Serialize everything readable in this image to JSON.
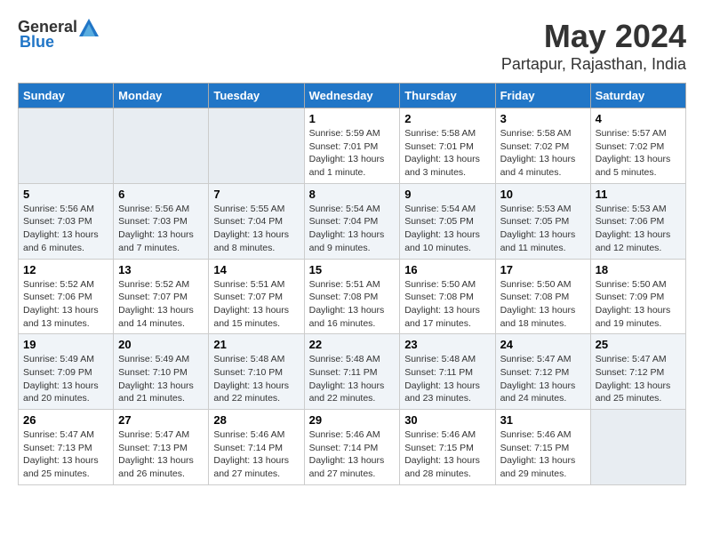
{
  "header": {
    "logo_general": "General",
    "logo_blue": "Blue",
    "title": "May 2024",
    "subtitle": "Partapur, Rajasthan, India"
  },
  "days_of_week": [
    "Sunday",
    "Monday",
    "Tuesday",
    "Wednesday",
    "Thursday",
    "Friday",
    "Saturday"
  ],
  "weeks": [
    [
      {
        "day": "",
        "info": ""
      },
      {
        "day": "",
        "info": ""
      },
      {
        "day": "",
        "info": ""
      },
      {
        "day": "1",
        "info": "Sunrise: 5:59 AM\nSunset: 7:01 PM\nDaylight: 13 hours and 1 minute."
      },
      {
        "day": "2",
        "info": "Sunrise: 5:58 AM\nSunset: 7:01 PM\nDaylight: 13 hours and 3 minutes."
      },
      {
        "day": "3",
        "info": "Sunrise: 5:58 AM\nSunset: 7:02 PM\nDaylight: 13 hours and 4 minutes."
      },
      {
        "day": "4",
        "info": "Sunrise: 5:57 AM\nSunset: 7:02 PM\nDaylight: 13 hours and 5 minutes."
      }
    ],
    [
      {
        "day": "5",
        "info": "Sunrise: 5:56 AM\nSunset: 7:03 PM\nDaylight: 13 hours and 6 minutes."
      },
      {
        "day": "6",
        "info": "Sunrise: 5:56 AM\nSunset: 7:03 PM\nDaylight: 13 hours and 7 minutes."
      },
      {
        "day": "7",
        "info": "Sunrise: 5:55 AM\nSunset: 7:04 PM\nDaylight: 13 hours and 8 minutes."
      },
      {
        "day": "8",
        "info": "Sunrise: 5:54 AM\nSunset: 7:04 PM\nDaylight: 13 hours and 9 minutes."
      },
      {
        "day": "9",
        "info": "Sunrise: 5:54 AM\nSunset: 7:05 PM\nDaylight: 13 hours and 10 minutes."
      },
      {
        "day": "10",
        "info": "Sunrise: 5:53 AM\nSunset: 7:05 PM\nDaylight: 13 hours and 11 minutes."
      },
      {
        "day": "11",
        "info": "Sunrise: 5:53 AM\nSunset: 7:06 PM\nDaylight: 13 hours and 12 minutes."
      }
    ],
    [
      {
        "day": "12",
        "info": "Sunrise: 5:52 AM\nSunset: 7:06 PM\nDaylight: 13 hours and 13 minutes."
      },
      {
        "day": "13",
        "info": "Sunrise: 5:52 AM\nSunset: 7:07 PM\nDaylight: 13 hours and 14 minutes."
      },
      {
        "day": "14",
        "info": "Sunrise: 5:51 AM\nSunset: 7:07 PM\nDaylight: 13 hours and 15 minutes."
      },
      {
        "day": "15",
        "info": "Sunrise: 5:51 AM\nSunset: 7:08 PM\nDaylight: 13 hours and 16 minutes."
      },
      {
        "day": "16",
        "info": "Sunrise: 5:50 AM\nSunset: 7:08 PM\nDaylight: 13 hours and 17 minutes."
      },
      {
        "day": "17",
        "info": "Sunrise: 5:50 AM\nSunset: 7:08 PM\nDaylight: 13 hours and 18 minutes."
      },
      {
        "day": "18",
        "info": "Sunrise: 5:50 AM\nSunset: 7:09 PM\nDaylight: 13 hours and 19 minutes."
      }
    ],
    [
      {
        "day": "19",
        "info": "Sunrise: 5:49 AM\nSunset: 7:09 PM\nDaylight: 13 hours and 20 minutes."
      },
      {
        "day": "20",
        "info": "Sunrise: 5:49 AM\nSunset: 7:10 PM\nDaylight: 13 hours and 21 minutes."
      },
      {
        "day": "21",
        "info": "Sunrise: 5:48 AM\nSunset: 7:10 PM\nDaylight: 13 hours and 22 minutes."
      },
      {
        "day": "22",
        "info": "Sunrise: 5:48 AM\nSunset: 7:11 PM\nDaylight: 13 hours and 22 minutes."
      },
      {
        "day": "23",
        "info": "Sunrise: 5:48 AM\nSunset: 7:11 PM\nDaylight: 13 hours and 23 minutes."
      },
      {
        "day": "24",
        "info": "Sunrise: 5:47 AM\nSunset: 7:12 PM\nDaylight: 13 hours and 24 minutes."
      },
      {
        "day": "25",
        "info": "Sunrise: 5:47 AM\nSunset: 7:12 PM\nDaylight: 13 hours and 25 minutes."
      }
    ],
    [
      {
        "day": "26",
        "info": "Sunrise: 5:47 AM\nSunset: 7:13 PM\nDaylight: 13 hours and 25 minutes."
      },
      {
        "day": "27",
        "info": "Sunrise: 5:47 AM\nSunset: 7:13 PM\nDaylight: 13 hours and 26 minutes."
      },
      {
        "day": "28",
        "info": "Sunrise: 5:46 AM\nSunset: 7:14 PM\nDaylight: 13 hours and 27 minutes."
      },
      {
        "day": "29",
        "info": "Sunrise: 5:46 AM\nSunset: 7:14 PM\nDaylight: 13 hours and 27 minutes."
      },
      {
        "day": "30",
        "info": "Sunrise: 5:46 AM\nSunset: 7:15 PM\nDaylight: 13 hours and 28 minutes."
      },
      {
        "day": "31",
        "info": "Sunrise: 5:46 AM\nSunset: 7:15 PM\nDaylight: 13 hours and 29 minutes."
      },
      {
        "day": "",
        "info": ""
      }
    ]
  ]
}
